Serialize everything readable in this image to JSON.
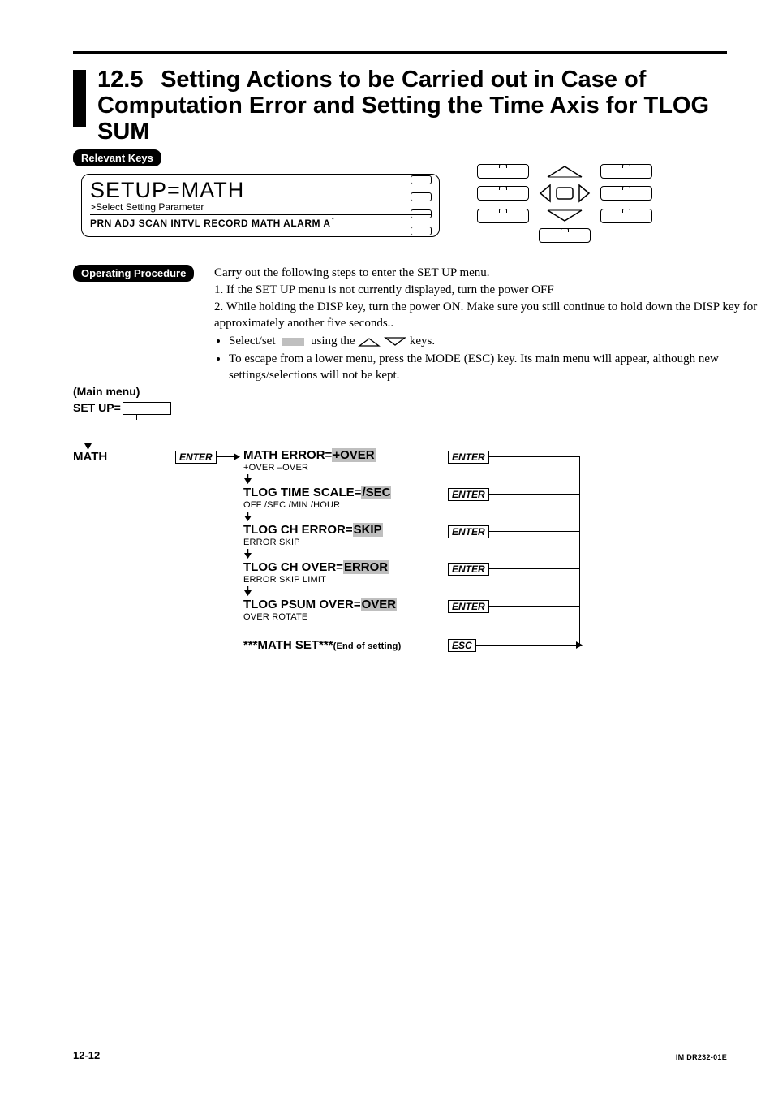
{
  "section_number": "12.5",
  "section_title": "Setting Actions to be Carried out in Case of Computation Error and Setting the Time Axis for TLOG SUM",
  "labels": {
    "relevant_keys": "Relevant Keys",
    "operating_procedure": "Operating Procedure"
  },
  "lcd": {
    "title": "SETUP=MATH",
    "subtitle": ">Select Setting Parameter",
    "menu": "PRN ADJ   SCAN INTVL   RECORD   MATH   ALARM   A"
  },
  "procedure": {
    "intro": "Carry out the following steps to enter the SET UP menu.",
    "step1": "1. If the SET UP menu is not currently displayed, turn the power OFF",
    "step2": "2. While holding the DISP key, turn the power ON.  Make sure you still continue to hold down the DISP key for approximately another five seconds..",
    "bullet1a": "Select/set ",
    "bullet1b": " using the ",
    "bullet1c": " keys.",
    "bullet2": "To escape from a lower menu, press the MODE (ESC) key.  Its main menu will appear, although new settings/selections will not be kept."
  },
  "flow": {
    "main_menu": "(Main menu)",
    "setup": "SET UP=",
    "math": "MATH",
    "enter": "ENTER",
    "esc": "ESC",
    "rows": [
      {
        "label": "MATH ERROR=",
        "value": "+OVER",
        "opts": "+OVER –OVER"
      },
      {
        "label": "TLOG TIME SCALE=",
        "value": "/SEC",
        "opts": "OFF /SEC /MIN /HOUR"
      },
      {
        "label": "TLOG CH ERROR=",
        "value": "SKIP",
        "opts": "ERROR SKIP"
      },
      {
        "label": "TLOG CH OVER=",
        "value": "ERROR",
        "opts": "ERROR SKIP LIMIT"
      },
      {
        "label": "TLOG PSUM OVER=",
        "value": "OVER",
        "opts": "OVER ROTATE"
      }
    ],
    "end_label": "***MATH SET***",
    "end_note": "(End of setting)"
  },
  "footer": {
    "page": "12-12",
    "doc": "IM DR232-01E"
  }
}
